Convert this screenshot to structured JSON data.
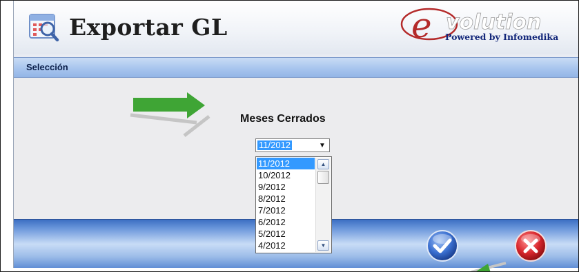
{
  "window": {
    "title": "Exportar GL",
    "logo_text": "volution",
    "logo_initial": "e",
    "logo_subtitle": "Powered by Infomedika"
  },
  "section": {
    "label": "Selección"
  },
  "form": {
    "label": "Meses Cerrados",
    "selected_value": "11/2012",
    "options": [
      "11/2012",
      "10/2012",
      "9/2012",
      "8/2012",
      "7/2012",
      "6/2012",
      "5/2012",
      "4/2012"
    ],
    "highlighted_index": 0
  },
  "buttons": {
    "ok_icon": "check-icon",
    "cancel_icon": "x-icon"
  },
  "icons": {
    "app": "calendar-search-icon",
    "annotation": "green-arrow-icon"
  },
  "colors": {
    "selection": "#3399ff",
    "header_band": "#a8c5ee",
    "annotation_arrow": "#3fa535",
    "cancel": "#d8262c",
    "ok": "#3a6fd0"
  }
}
